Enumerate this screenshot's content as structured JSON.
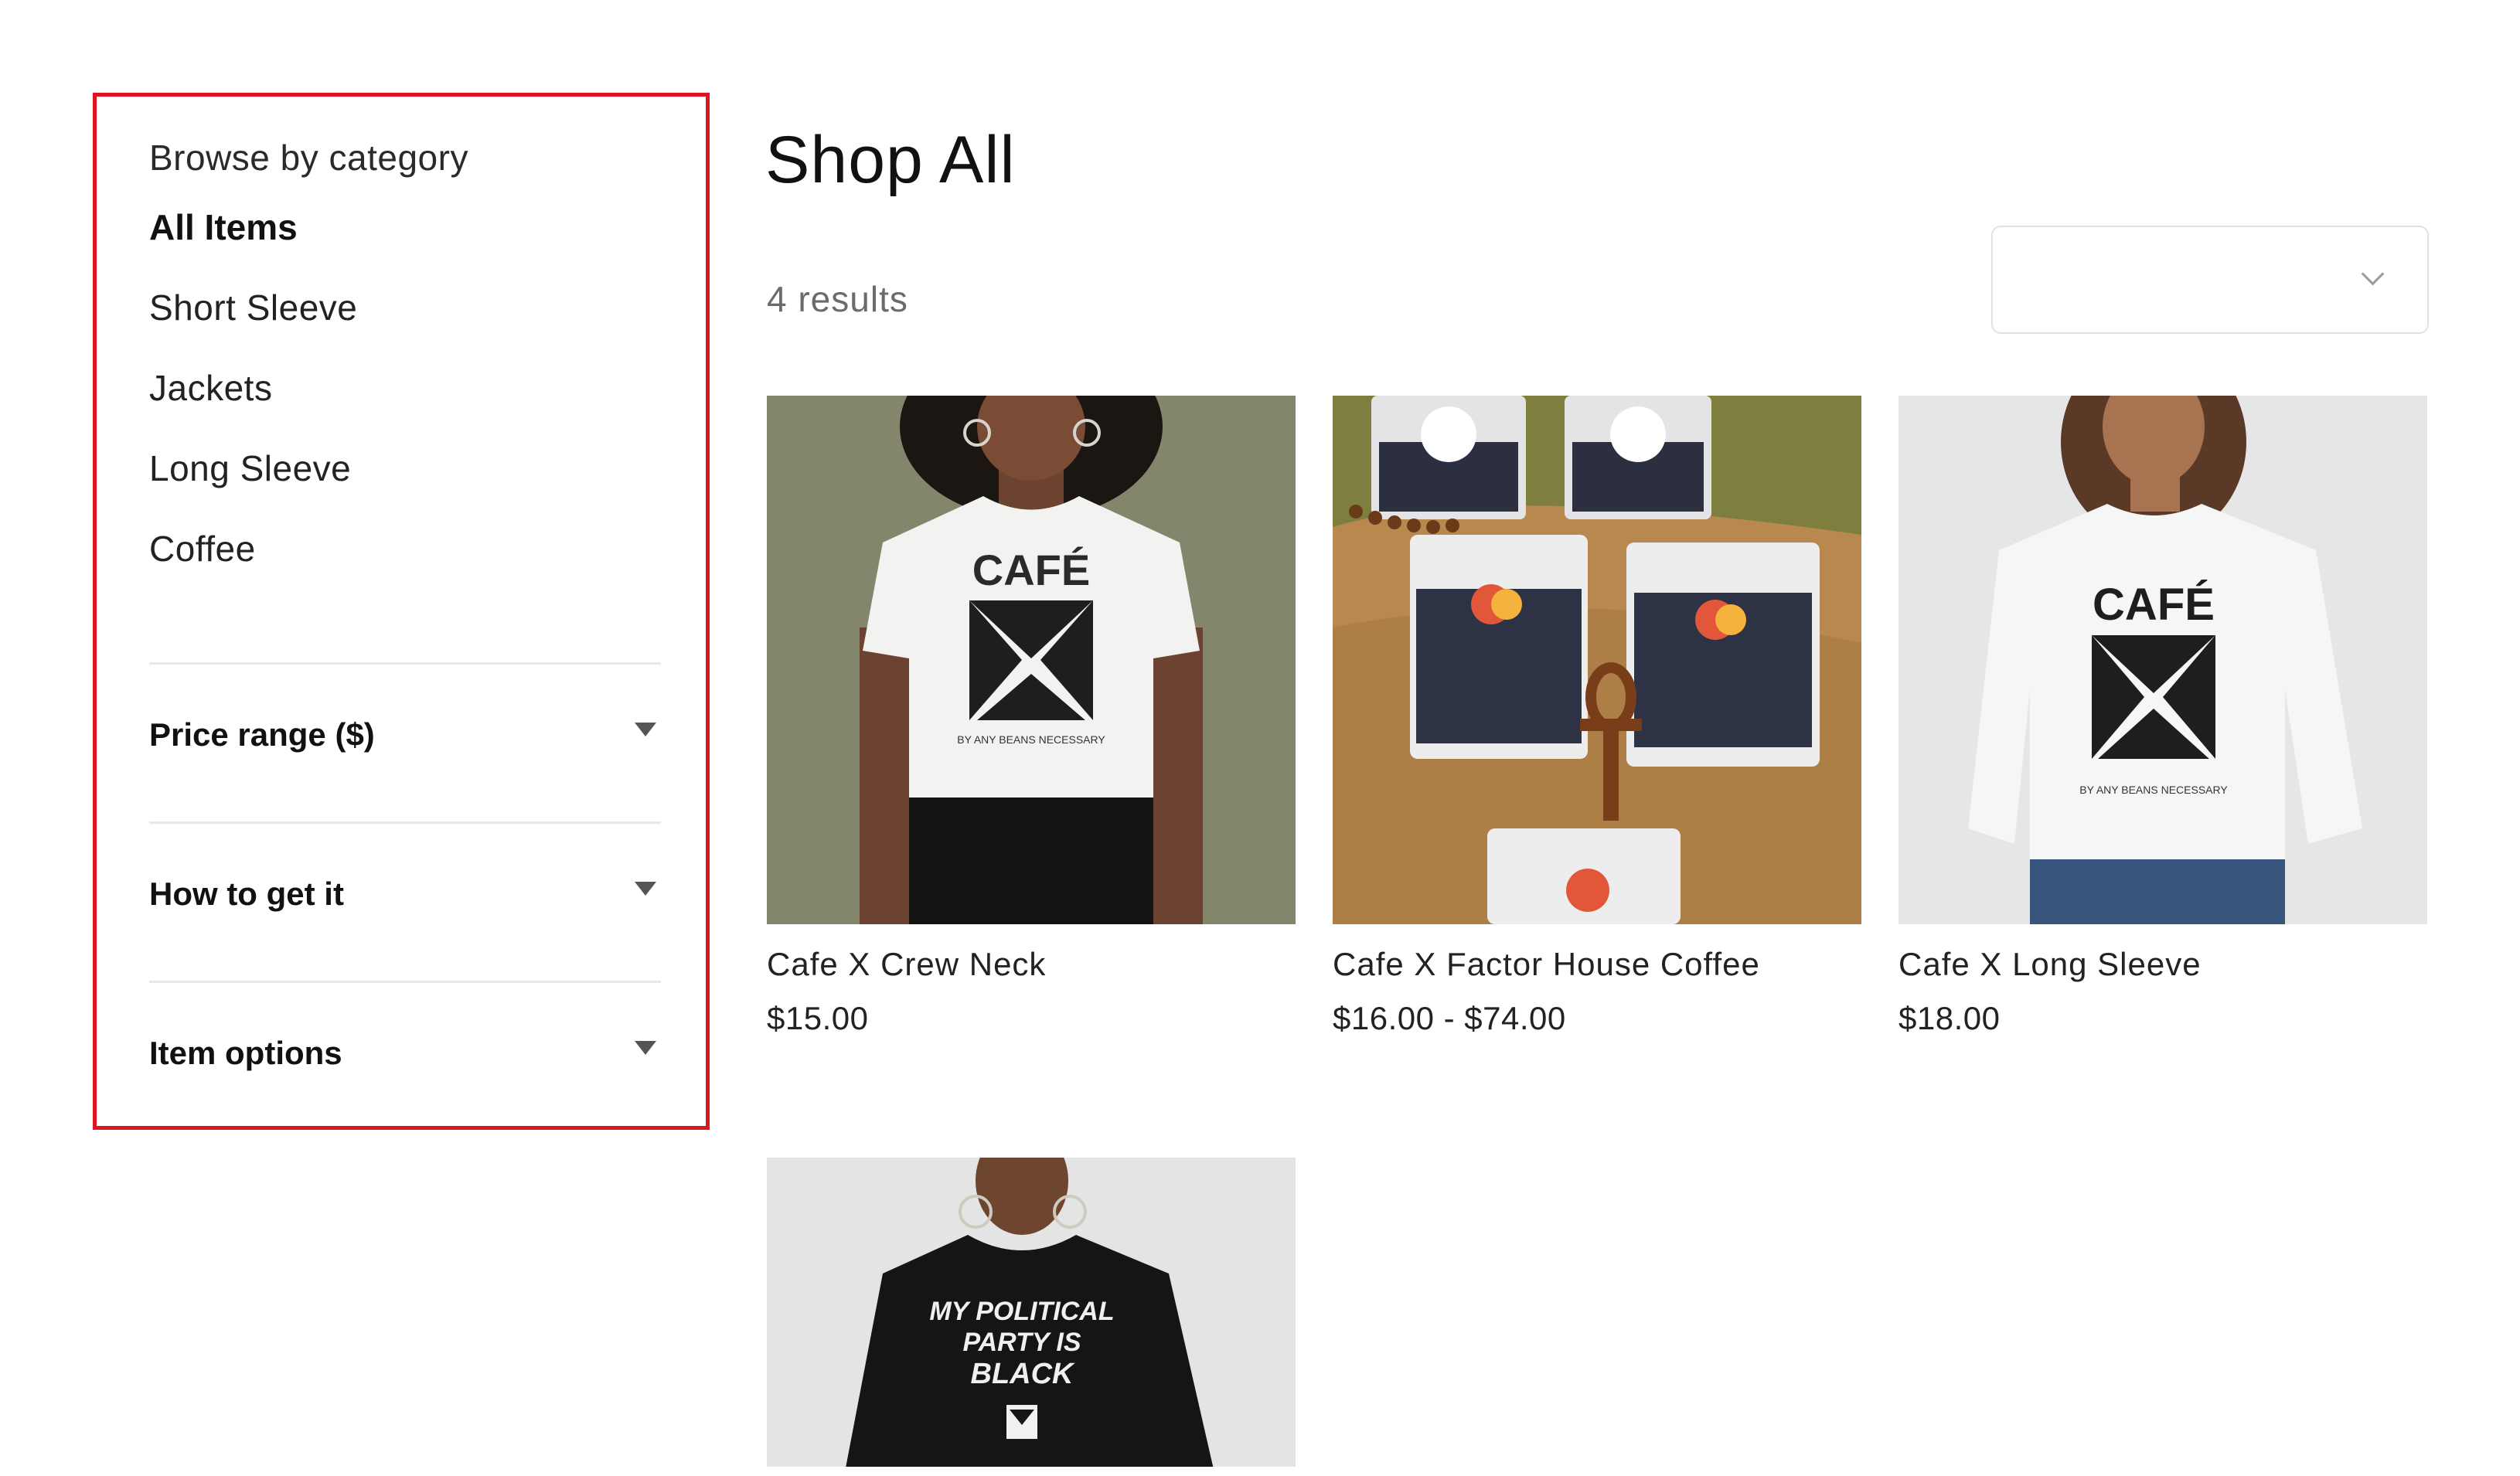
{
  "sidebar": {
    "title": "Browse by category",
    "categories": [
      {
        "label": "All Items",
        "active": true
      },
      {
        "label": "Short Sleeve",
        "active": false
      },
      {
        "label": "Jackets",
        "active": false
      },
      {
        "label": "Long Sleeve",
        "active": false
      },
      {
        "label": "Coffee",
        "active": false
      }
    ],
    "filters": [
      {
        "label": "Price range ($)",
        "icon": "caret-down-icon"
      },
      {
        "label": "How to get it",
        "icon": "caret-down-icon"
      },
      {
        "label": "Item options",
        "icon": "caret-down-icon"
      }
    ],
    "highlight_color": "#e0141e"
  },
  "main": {
    "title": "Shop All",
    "results": "4 results",
    "sort": {
      "value": "",
      "icon": "chevron-down-icon"
    },
    "products": [
      {
        "name": "Cafe X Crew Neck",
        "price": "$15.00",
        "image": "white t-shirt model photo"
      },
      {
        "name": "Cafe X Factor House Coffee",
        "price": "$16.00 - $74.00",
        "image": "coffee bags photo"
      },
      {
        "name": "Cafe X Long Sleeve",
        "price": "$18.00",
        "image": "white long sleeve model photo"
      },
      {
        "name": "",
        "price": "",
        "image": "black hoodie model photo"
      }
    ]
  }
}
